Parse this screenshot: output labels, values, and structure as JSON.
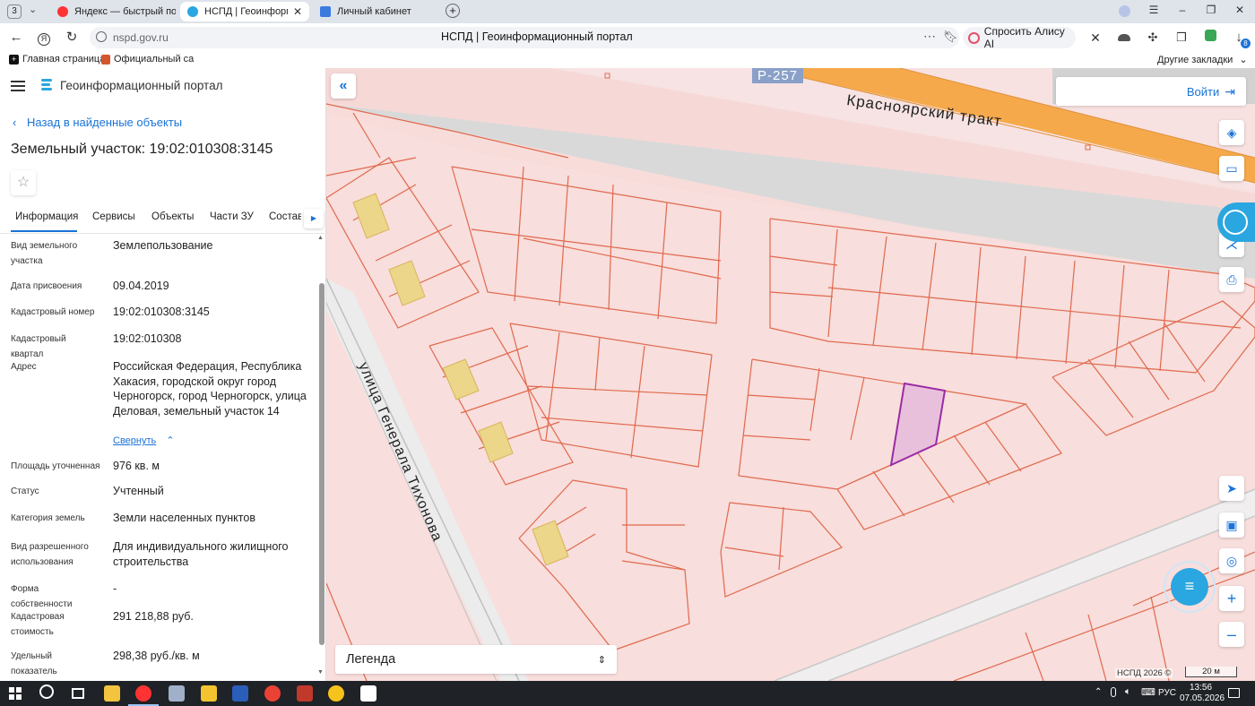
{
  "browser": {
    "tab_count": "3",
    "tabs": [
      {
        "label": "Яндекс — быстрый поиск"
      },
      {
        "label": "НСПД | Геоинформационн"
      },
      {
        "label": "Личный кабинет"
      }
    ],
    "url": "nspd.gov.ru",
    "page_title": "НСПД | Геоинформационный портал",
    "alice_label": "Спросить Алису AI",
    "bookmarks": [
      "Главная страница",
      "Официальный са"
    ],
    "other_bookmarks": "Другие закладки",
    "download_badge": "8"
  },
  "portal": {
    "title": "Геоинформационный портал",
    "back_link": "Назад в найденные объекты",
    "object_title": "Земельный участок: 19:02:010308:3145",
    "tabs": [
      "Информация",
      "Сервисы",
      "Объекты",
      "Части ЗУ",
      "Состав"
    ],
    "rows": [
      {
        "label": "Вид земельного участка",
        "value": "Землепользование"
      },
      {
        "label": "Дата присвоения",
        "value": "09.04.2019"
      },
      {
        "label": "Кадастровый номер",
        "value": "19:02:010308:3145"
      },
      {
        "label": "Кадастровый квартал",
        "value": "19:02:010308"
      },
      {
        "label": "Адрес",
        "value": "Российская Федерация, Республика Хакасия, городской округ город Черногорск, город Черногорск, улица Деловая, земельный участок 14"
      },
      {
        "label": "Площадь уточненная",
        "value": "976 кв. м"
      },
      {
        "label": "Статус",
        "value": "Учтенный"
      },
      {
        "label": "Категория земель",
        "value": "Земли населенных пунктов"
      },
      {
        "label": "Вид разрешенного использования",
        "value": "Для индивидуального жилищного строительства"
      },
      {
        "label": "Форма собственности",
        "value": "-"
      },
      {
        "label": "Кадастровая стоимость",
        "value": "291 218,88 руб."
      },
      {
        "label": "Удельный показатель кадастровой",
        "value": "298,38 руб./кв. м"
      }
    ],
    "collapse_link": "Свернуть"
  },
  "map": {
    "road_badge": "Р-257",
    "road_name": "Красноярский тракт",
    "street_name": "улица Генерала Тихонова",
    "login_label": "Войти",
    "legend_label": "Легенда",
    "copyright": "НСПД 2026 ©",
    "scale": "20 м"
  },
  "taskbar": {
    "lang": "РУС",
    "time": "13:56",
    "date": "07.05.2026"
  },
  "colors": {
    "accent": "#1a73d9",
    "parcel_line": "#e0694e",
    "selected_parcel": "#e9c0dc",
    "road_orange": "#f5a94a"
  }
}
